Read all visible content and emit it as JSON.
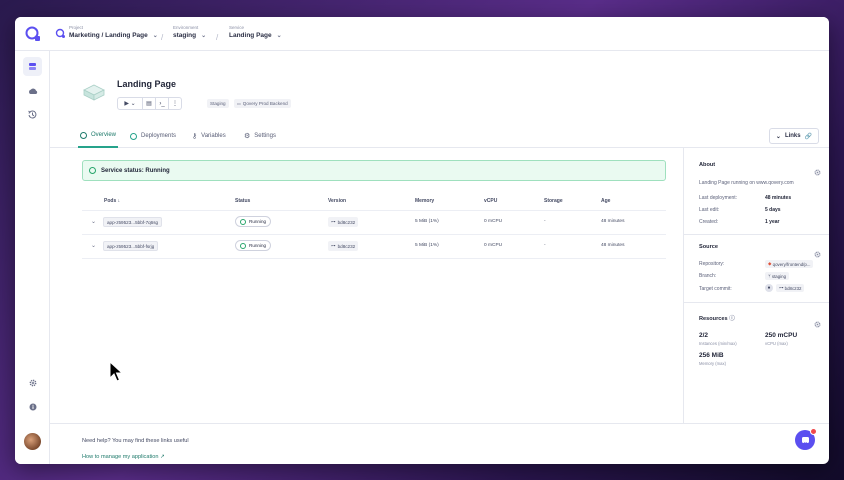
{
  "breadcrumbs": [
    {
      "label": "Project",
      "value": "Marketing / Landing Page"
    },
    {
      "label": "Environment",
      "value": "staging"
    },
    {
      "label": "Service",
      "value": "Landing Page"
    }
  ],
  "service": {
    "title": "Landing Page",
    "env_tag": "Staging",
    "cluster_tag": "Qovery Prod Backend"
  },
  "tabs": [
    {
      "label": "Overview",
      "icon": "check-circle-icon",
      "active": true
    },
    {
      "label": "Deployments",
      "icon": "check-circle-icon",
      "active": false
    },
    {
      "label": "Variables",
      "icon": "key-icon",
      "active": false
    },
    {
      "label": "Settings",
      "icon": "gear-icon",
      "active": false
    }
  ],
  "links_button": "Links",
  "service_status": "Service status: Running",
  "table": {
    "headers": [
      "Pods",
      "Status",
      "Version",
      "Memory",
      "vCPU",
      "Storage",
      "Age"
    ],
    "rows": [
      {
        "pod": "app-z59523...5bbf-7q6sg",
        "status": "Running",
        "version": "bd8c232",
        "memory": "5 MiB (1%)",
        "vcpu": "0 mCPU",
        "storage": "-",
        "age": "48 minutes"
      },
      {
        "pod": "app-z59523...5bbf-fsrjg",
        "status": "Running",
        "version": "bd8c232",
        "memory": "5 MiB (1%)",
        "vcpu": "0 mCPU",
        "storage": "-",
        "age": "48 minutes"
      }
    ]
  },
  "about": {
    "title": "About",
    "description": "Landing Page running on www.qovery.com",
    "last_deployment_label": "Last deployment:",
    "last_deployment_value": "48 minutes",
    "last_edit_label": "Last edit:",
    "last_edit_value": "5 days",
    "created_label": "Created:",
    "created_value": "1 year"
  },
  "source": {
    "title": "Source",
    "repository_label": "Repository:",
    "repository_value": "qovery/frontend/p...",
    "branch_label": "Branch:",
    "branch_value": "staging",
    "target_commit_label": "Target commit:",
    "target_commit_value": "bd8c232"
  },
  "resources": {
    "title": "Resources",
    "instances_value": "2/2",
    "instances_label": "Instances (min/max)",
    "vcpu_value": "250 mCPU",
    "vcpu_label": "vCPU (max)",
    "memory_value": "256 MiB",
    "memory_label": "Memory (max)"
  },
  "footer": {
    "help_text": "Need help? You may find these links useful",
    "link_text": "How to manage my application"
  },
  "colors": {
    "accent": "#26a38b",
    "chat": "#5b4ff0",
    "banner_bg": "#eafaf1"
  }
}
